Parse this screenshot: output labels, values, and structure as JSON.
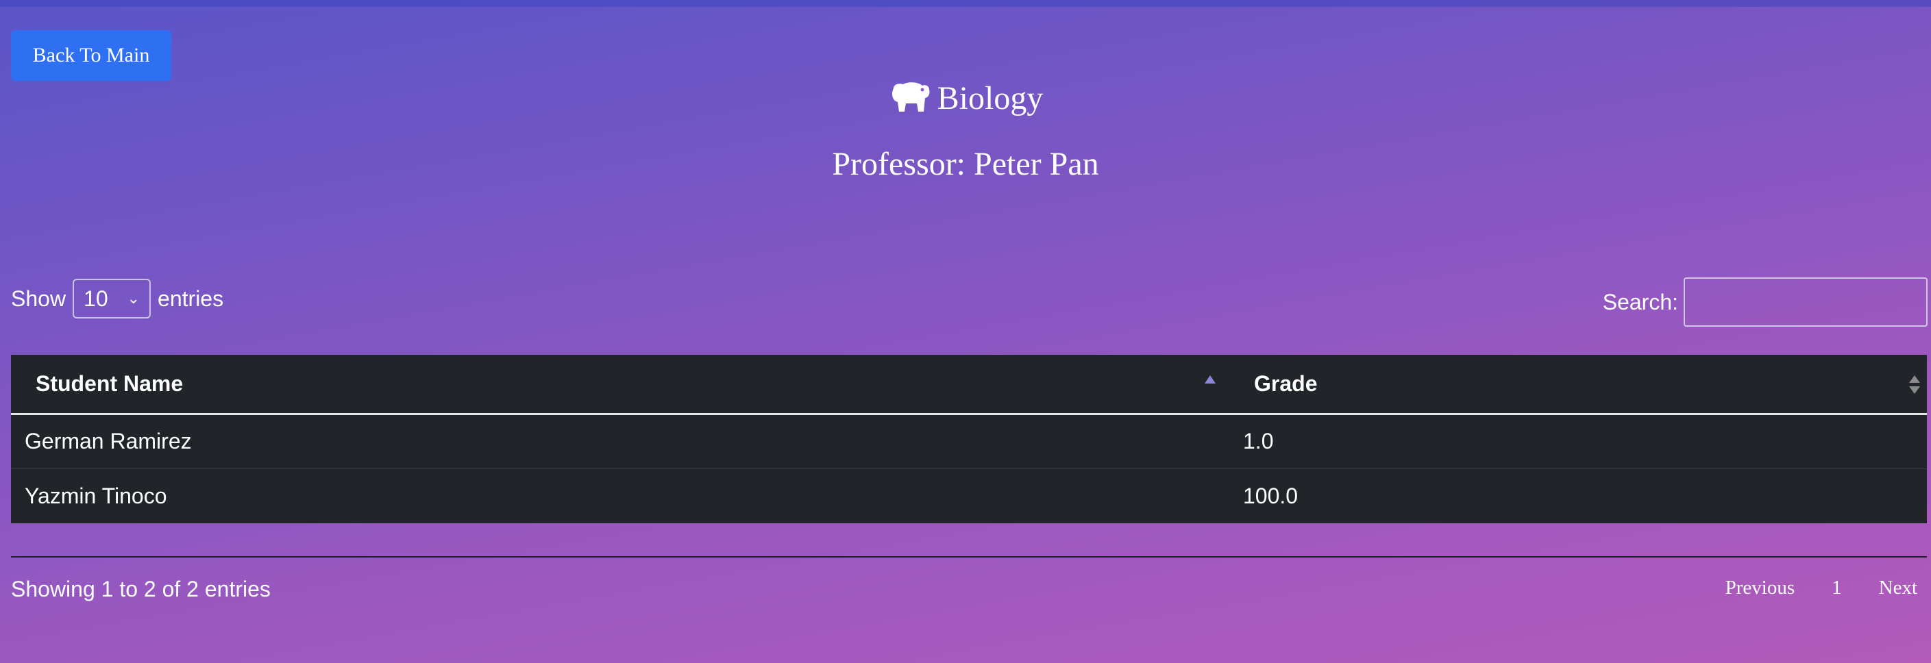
{
  "nav": {
    "back_label": "Back To Main"
  },
  "header": {
    "title": "Biology",
    "icon": "hippo-icon",
    "professor": "Professor: Peter Pan"
  },
  "length": {
    "show_label": "Show",
    "selected": "10",
    "entries_label": "entries"
  },
  "search": {
    "label": "Search:",
    "value": "",
    "placeholder": ""
  },
  "table": {
    "headers": [
      "Student Name",
      "Grade"
    ],
    "rows": [
      {
        "name": "German Ramirez",
        "grade": "1.0"
      },
      {
        "name": "Yazmin Tinoco",
        "grade": "100.0"
      }
    ]
  },
  "footer": {
    "info": "Showing 1 to 2 of 2 entries",
    "previous": "Previous",
    "page": "1",
    "next": "Next"
  },
  "colors": {
    "button": "#2f6ff1",
    "table_bg": "#212529",
    "gradient_start": "#5a55c8",
    "gradient_end": "#b25bbb"
  }
}
